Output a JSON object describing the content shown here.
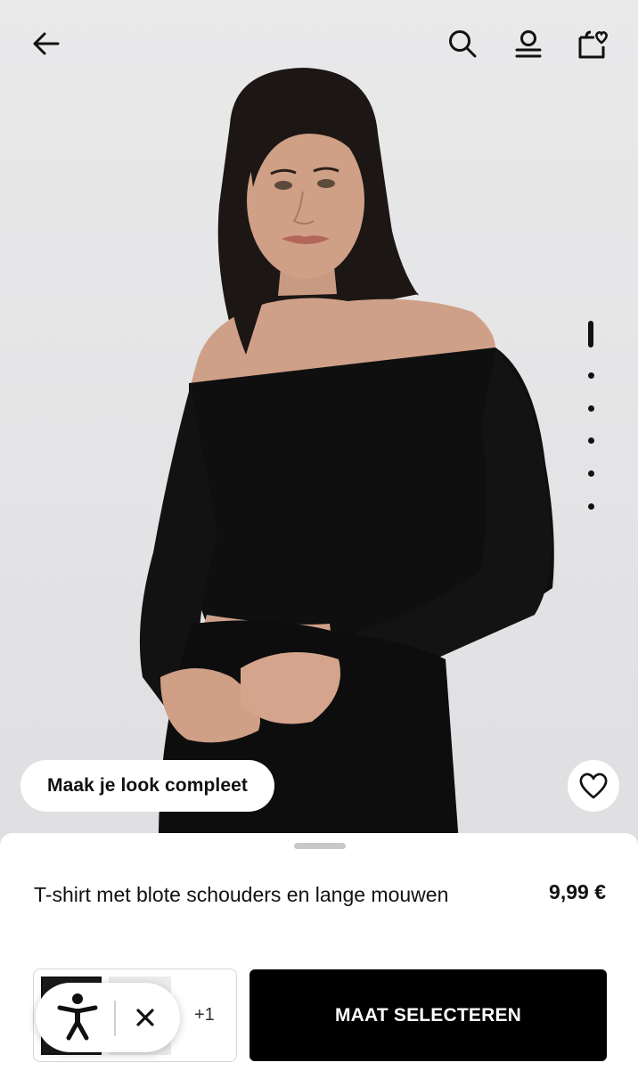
{
  "nav": {
    "back_icon": "arrow-left-icon",
    "search_icon": "search-icon",
    "account_icon": "user-icon",
    "bag_icon": "shopping-bag-heart-icon"
  },
  "gallery": {
    "image_count": 6,
    "active_index": 0,
    "complete_look_label": "Maak je look compleet",
    "favorite_icon": "heart-icon"
  },
  "product": {
    "title": "T-shirt met blote schouders en lange mouwen",
    "price": "9,99 €",
    "more_colors": "+1",
    "swatches": [
      "black",
      "light-grey"
    ],
    "cta_label": "MAAT SELECTEREN"
  },
  "accessibility": {
    "icon": "accessibility-person-icon",
    "close_icon": "close-icon"
  },
  "colors": {
    "primary": "#000000",
    "background": "#ffffff",
    "hero_bg": "#e6e6e8"
  }
}
